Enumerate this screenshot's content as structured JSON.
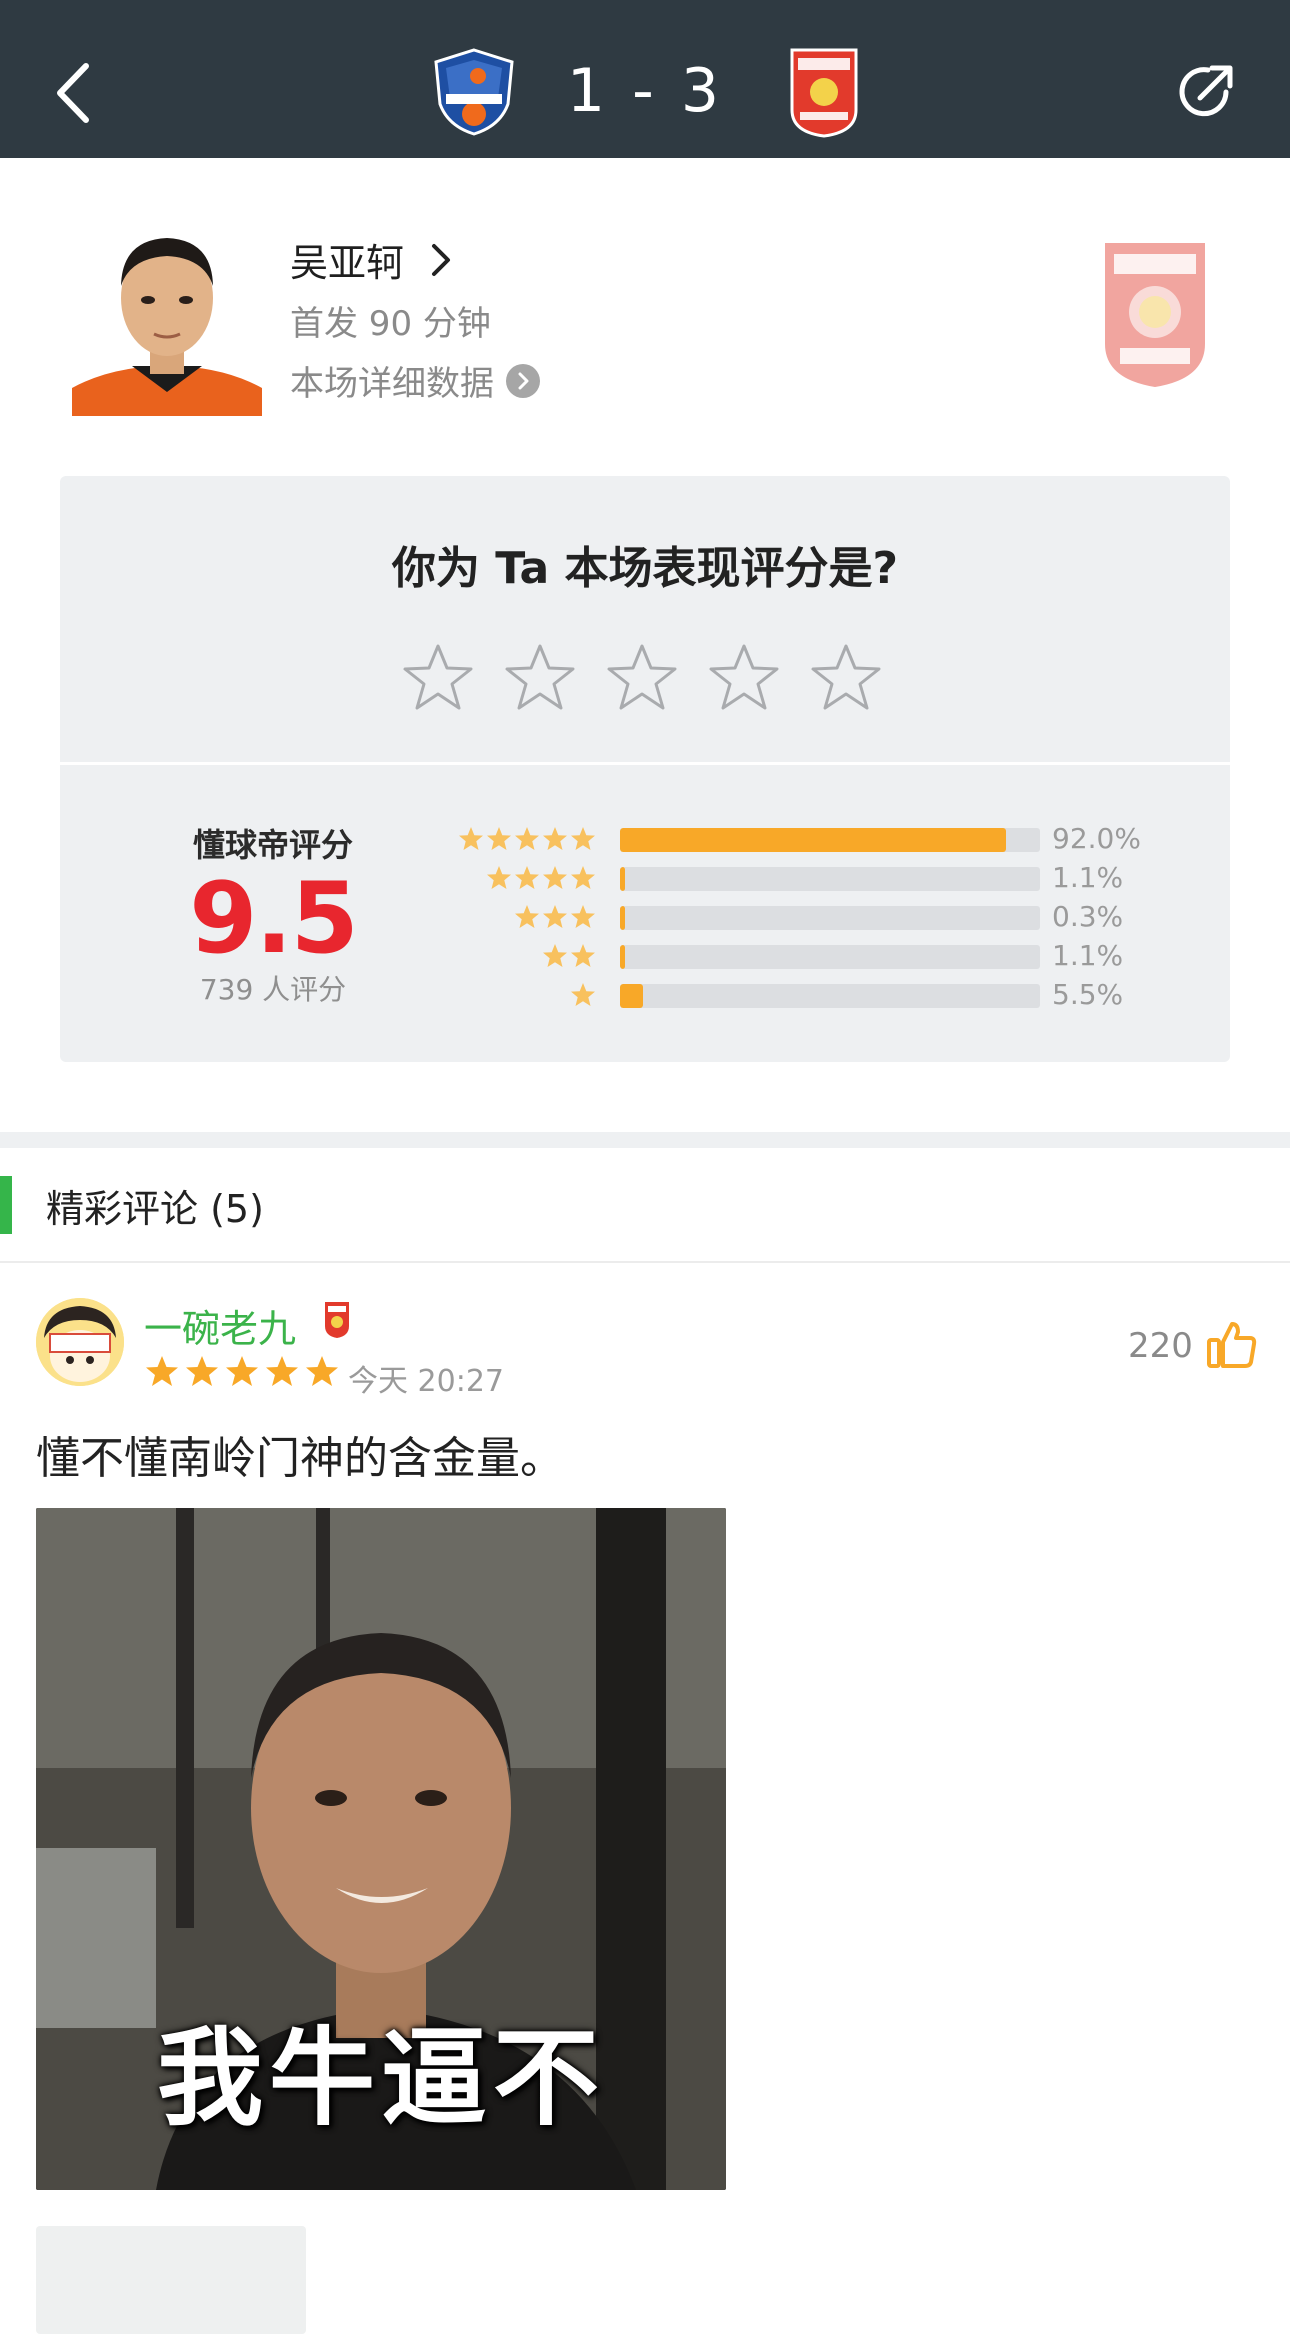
{
  "header": {
    "score": "1 - 3",
    "home_team_icon": "shenzhen-fc-logo",
    "away_team_icon": "changchun-yatai-logo",
    "back_icon": "chevron-left-icon",
    "share_icon": "share-icon"
  },
  "player": {
    "name": "吴亚轲",
    "subtitle": "首发 90 分钟",
    "detail_link": "本场详细数据",
    "club_badge_icon": "changchun-yatai-badge"
  },
  "rating": {
    "question": "你为 Ta 本场表现评分是?",
    "star_count": 5,
    "label": "懂球帝评分",
    "score": "9.5",
    "count_text": "739 人评分",
    "distribution": [
      {
        "stars": 5,
        "percent_text": "92.0%",
        "fraction": 0.92
      },
      {
        "stars": 4,
        "percent_text": "1.1%",
        "fraction": 0.011
      },
      {
        "stars": 3,
        "percent_text": "0.3%",
        "fraction": 0.003
      },
      {
        "stars": 2,
        "percent_text": "1.1%",
        "fraction": 0.011
      },
      {
        "stars": 1,
        "percent_text": "5.5%",
        "fraction": 0.055
      }
    ],
    "colors": {
      "accent": "#f8a828",
      "score": "#e8262e",
      "track": "#dcdee1"
    }
  },
  "comments_section": {
    "title": "精彩评论 (5)",
    "accent_color": "#35b54a"
  },
  "comments": [
    {
      "username": "一碗老九",
      "stars": 5,
      "time": "今天 20:27",
      "likes": "220",
      "text": "懂不懂南岭门神的含金量。",
      "image_caption": "我牛逼不"
    }
  ]
}
